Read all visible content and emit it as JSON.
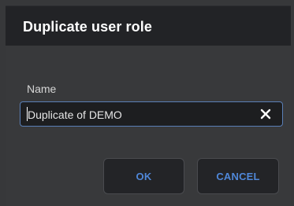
{
  "dialog": {
    "title": "Duplicate user role",
    "name_label": "Name",
    "name_value": "Duplicate of DEMO",
    "ok_label": "OK",
    "cancel_label": "CANCEL"
  },
  "colors": {
    "accent": "#4f87d8",
    "background": "#37383a",
    "titlebar": "#222326",
    "input_background": "#1d1e20",
    "input_border": "#5a7fb6"
  },
  "icons": {
    "clear": "close-icon"
  }
}
